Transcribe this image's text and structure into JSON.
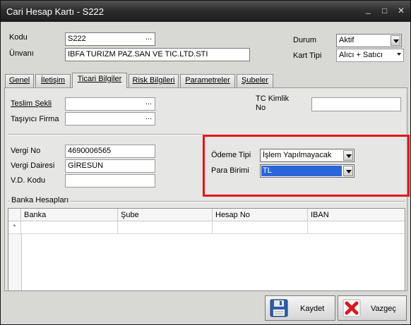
{
  "window": {
    "title": "Cari Hesap Kartı - S222"
  },
  "header": {
    "kodu_label": "Kodu",
    "kodu_value": "S222",
    "unvani_label": "Ünvanı",
    "unvani_value": "IBFA TURIZM PAZ.SAN VE TIC.LTD.STI",
    "durum_label": "Durum",
    "durum_value": "Aktif",
    "kart_tipi_label": "Kart Tipi",
    "kart_tipi_value": "Alıcı + Satıcı"
  },
  "tabs": [
    {
      "label": "Genel",
      "active": false
    },
    {
      "label": "İletişim",
      "active": false
    },
    {
      "label": "Ticari Bilgiler",
      "active": true
    },
    {
      "label": "Risk Bilgileri",
      "active": false
    },
    {
      "label": "Parametreler",
      "active": false
    },
    {
      "label": "Şubeler",
      "active": false
    }
  ],
  "ticari": {
    "teslim_sekli_label": "Teslim Şekli",
    "teslim_sekli_value": "",
    "tasiyici_firma_label": "Taşıyıcı Firma",
    "tasiyici_firma_value": "",
    "tc_kimlik_label_1": "TC Kimlik",
    "tc_kimlik_label_2": "No",
    "tc_kimlik_value": "",
    "vergi_no_label": "Vergi No",
    "vergi_no_value": "4690006565",
    "vergi_dairesi_label": "Vergi Dairesi",
    "vergi_dairesi_value": "GİRESUN",
    "vd_kodu_label": "V.D. Kodu",
    "vd_kodu_value": "",
    "odeme_tipi_label": "Ödeme Tipi",
    "odeme_tipi_value": "İşlem Yapılmayacak",
    "para_birimi_label": "Para Birimi",
    "para_birimi_value": "TL"
  },
  "banka": {
    "section_label": "Banka Hesapları",
    "columns": [
      "Banka",
      "Şube",
      "Hesap No",
      "IBAN"
    ],
    "new_row_marker": "*"
  },
  "buttons": {
    "save_label": "Kaydet",
    "cancel_label": "Vazgeç"
  },
  "colors": {
    "highlight_border": "#e8141c",
    "selection": "#2a66d9"
  },
  "icons": {
    "ellipsis": "...",
    "save": "floppy-disk-icon",
    "cancel": "red-x-icon"
  }
}
